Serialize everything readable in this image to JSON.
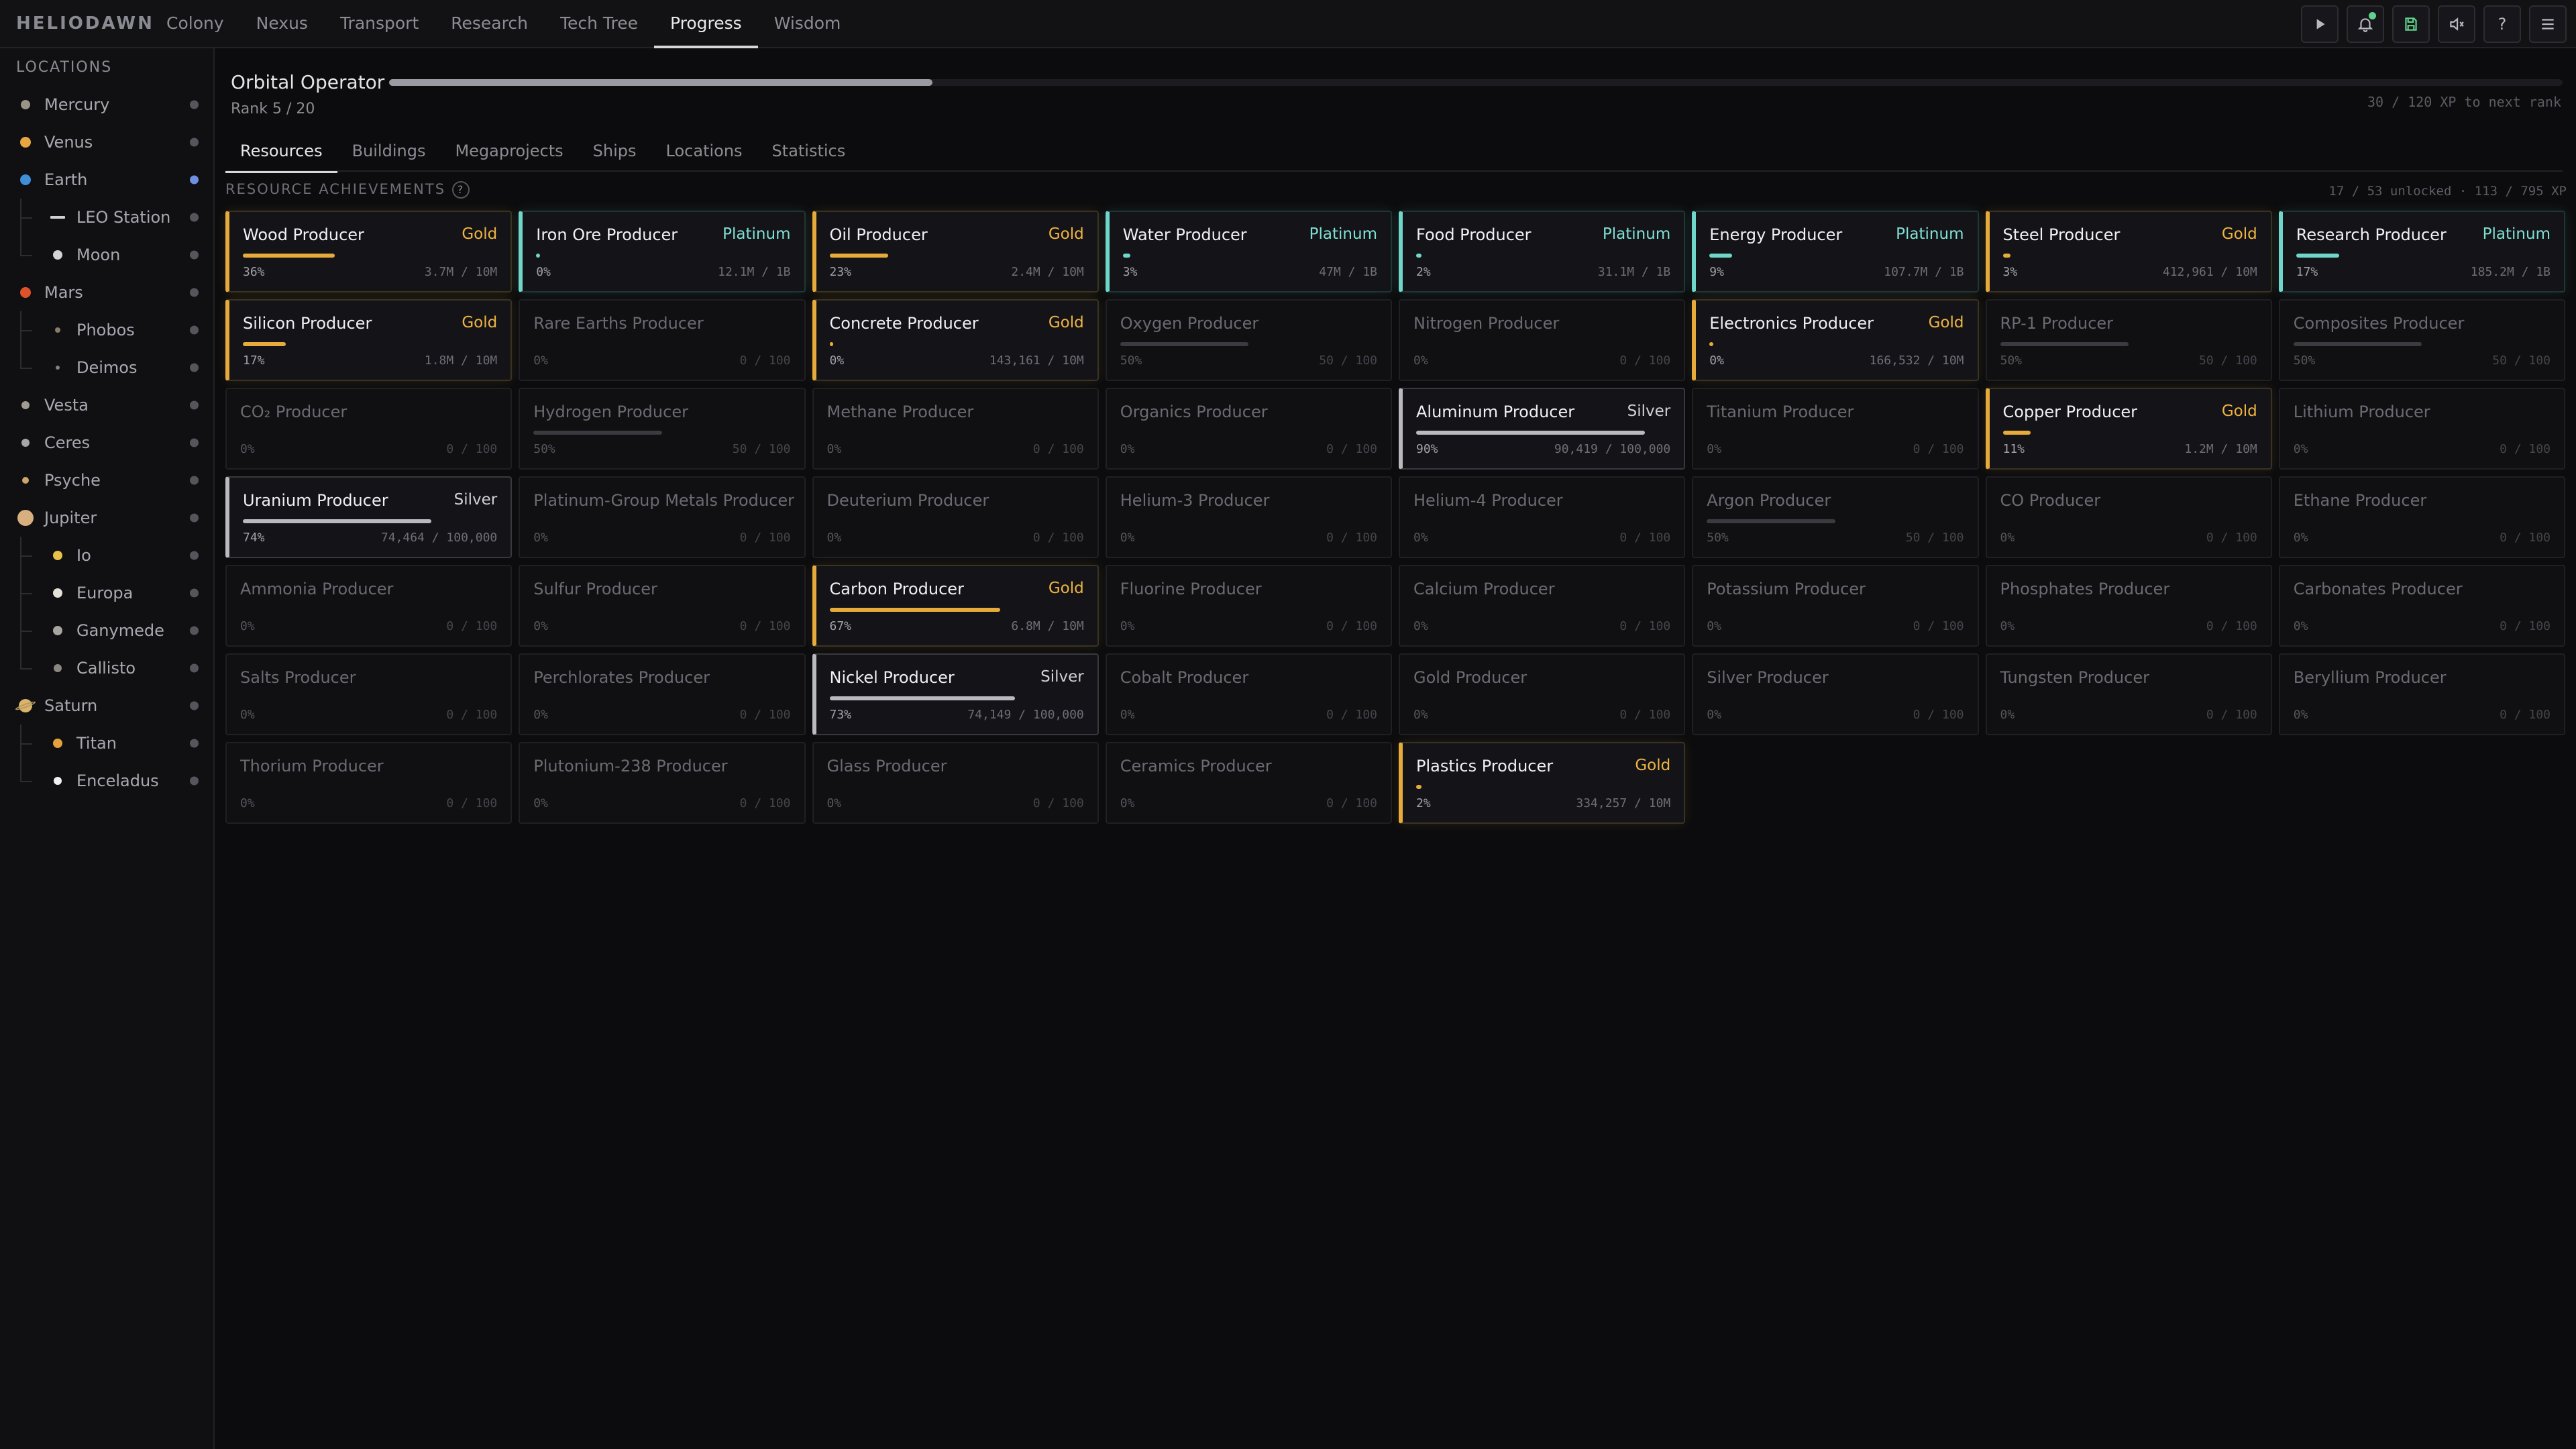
{
  "app": {
    "brand": "HELIODAWN"
  },
  "nav": {
    "tabs": [
      "Colony",
      "Nexus",
      "Transport",
      "Research",
      "Tech Tree",
      "Progress",
      "Wisdom"
    ],
    "active": "Progress"
  },
  "toolbar": {
    "icons": [
      "play-icon",
      "bell-icon",
      "save-icon",
      "mute-icon",
      "help-icon",
      "menu-icon"
    ],
    "help_glyph": "?"
  },
  "sidebar": {
    "title": "LOCATIONS",
    "items": [
      {
        "label": "Mercury",
        "depth": 0,
        "color": "#9a9388",
        "size": 14
      },
      {
        "label": "Venus",
        "depth": 0,
        "color": "#e6a640",
        "size": 16
      },
      {
        "label": "Earth",
        "depth": 0,
        "color": "#3f8fd8",
        "size": 16,
        "status_color": "#6f8fe0"
      },
      {
        "label": "LEO Station",
        "depth": 1,
        "color": "#cfcfd4",
        "size": 6,
        "icon": "station"
      },
      {
        "label": "Moon",
        "depth": 1,
        "color": "#d4d4d8",
        "size": 14
      },
      {
        "label": "Mars",
        "depth": 0,
        "color": "#e0532a",
        "size": 16
      },
      {
        "label": "Phobos",
        "depth": 1,
        "color": "#8a7a66",
        "size": 8
      },
      {
        "label": "Deimos",
        "depth": 1,
        "color": "#8a8078",
        "size": 6
      },
      {
        "label": "Vesta",
        "depth": 0,
        "color": "#a09a90",
        "size": 12
      },
      {
        "label": "Ceres",
        "depth": 0,
        "color": "#a6a6a6",
        "size": 12
      },
      {
        "label": "Psyche",
        "depth": 0,
        "color": "#c9a86a",
        "size": 10
      },
      {
        "label": "Jupiter",
        "depth": 0,
        "color": "#d8b080",
        "size": 24
      },
      {
        "label": "Io",
        "depth": 1,
        "color": "#e8c04a",
        "size": 14
      },
      {
        "label": "Europa",
        "depth": 1,
        "color": "#e6e2d8",
        "size": 14
      },
      {
        "label": "Ganymede",
        "depth": 1,
        "color": "#a8a49e",
        "size": 14
      },
      {
        "label": "Callisto",
        "depth": 1,
        "color": "#8a8680",
        "size": 12
      },
      {
        "label": "Saturn",
        "depth": 0,
        "color": "#d9b46a",
        "size": 20,
        "icon": "ringed"
      },
      {
        "label": "Titan",
        "depth": 1,
        "color": "#e4a23c",
        "size": 14
      },
      {
        "label": "Enceladus",
        "depth": 1,
        "color": "#f0f0f4",
        "size": 12
      }
    ]
  },
  "rank": {
    "title": "Orbital Operator",
    "subtitle": "Rank 5 / 20",
    "xp_text": "30 / 120 XP to next rank",
    "xp_fraction": 0.25
  },
  "subtabs": {
    "items": [
      "Resources",
      "Buildings",
      "Megaprojects",
      "Ships",
      "Locations",
      "Statistics"
    ],
    "active": "Resources"
  },
  "section": {
    "title": "RESOURCE ACHIEVEMENTS",
    "help": "?",
    "summary": "17 / 53 unlocked · 113 / 795 XP"
  },
  "tier_colors": {
    "Gold": "#e6ab3a",
    "Platinum": "#6fd6c9",
    "Silver": "#b9b9c0",
    "none": "#3a3a40"
  },
  "achievements": [
    {
      "name": "Wood Producer",
      "tier": "Gold",
      "pct": "36%",
      "progress": 0.36,
      "value": "3.7M / 10M"
    },
    {
      "name": "Iron Ore Producer",
      "tier": "Platinum",
      "pct": "0%",
      "progress": 0.01,
      "value": "12.1M / 1B"
    },
    {
      "name": "Oil Producer",
      "tier": "Gold",
      "pct": "23%",
      "progress": 0.23,
      "value": "2.4M / 10M"
    },
    {
      "name": "Water Producer",
      "tier": "Platinum",
      "pct": "3%",
      "progress": 0.03,
      "value": "47M / 1B"
    },
    {
      "name": "Food Producer",
      "tier": "Platinum",
      "pct": "2%",
      "progress": 0.02,
      "value": "31.1M / 1B"
    },
    {
      "name": "Energy Producer",
      "tier": "Platinum",
      "pct": "9%",
      "progress": 0.09,
      "value": "107.7M / 1B"
    },
    {
      "name": "Steel Producer",
      "tier": "Gold",
      "pct": "3%",
      "progress": 0.03,
      "value": "412,961 / 10M"
    },
    {
      "name": "Research Producer",
      "tier": "Platinum",
      "pct": "17%",
      "progress": 0.17,
      "value": "185.2M / 1B"
    },
    {
      "name": "Silicon Producer",
      "tier": "Gold",
      "pct": "17%",
      "progress": 0.17,
      "value": "1.8M / 10M"
    },
    {
      "name": "Rare Earths Producer",
      "tier": "",
      "pct": "0%",
      "progress": 0,
      "value": "0 / 100"
    },
    {
      "name": "Concrete Producer",
      "tier": "Gold",
      "pct": "0%",
      "progress": 0.01,
      "value": "143,161 / 10M"
    },
    {
      "name": "Oxygen Producer",
      "tier": "",
      "pct": "50%",
      "progress": 0.5,
      "value": "50 / 100"
    },
    {
      "name": "Nitrogen Producer",
      "tier": "",
      "pct": "0%",
      "progress": 0,
      "value": "0 / 100"
    },
    {
      "name": "Electronics Producer",
      "tier": "Gold",
      "pct": "0%",
      "progress": 0.01,
      "value": "166,532 / 10M"
    },
    {
      "name": "RP-1 Producer",
      "tier": "",
      "pct": "50%",
      "progress": 0.5,
      "value": "50 / 100"
    },
    {
      "name": "Composites Producer",
      "tier": "",
      "pct": "50%",
      "progress": 0.5,
      "value": "50 / 100"
    },
    {
      "name": "CO₂ Producer",
      "tier": "",
      "pct": "0%",
      "progress": 0,
      "value": "0 / 100"
    },
    {
      "name": "Hydrogen Producer",
      "tier": "",
      "pct": "50%",
      "progress": 0.5,
      "value": "50 / 100"
    },
    {
      "name": "Methane Producer",
      "tier": "",
      "pct": "0%",
      "progress": 0,
      "value": "0 / 100"
    },
    {
      "name": "Organics Producer",
      "tier": "",
      "pct": "0%",
      "progress": 0,
      "value": "0 / 100"
    },
    {
      "name": "Aluminum Producer",
      "tier": "Silver",
      "pct": "90%",
      "progress": 0.9,
      "value": "90,419 / 100,000"
    },
    {
      "name": "Titanium Producer",
      "tier": "",
      "pct": "0%",
      "progress": 0,
      "value": "0 / 100"
    },
    {
      "name": "Copper Producer",
      "tier": "Gold",
      "pct": "11%",
      "progress": 0.11,
      "value": "1.2M / 10M"
    },
    {
      "name": "Lithium Producer",
      "tier": "",
      "pct": "0%",
      "progress": 0,
      "value": "0 / 100"
    },
    {
      "name": "Uranium Producer",
      "tier": "Silver",
      "pct": "74%",
      "progress": 0.74,
      "value": "74,464 / 100,000"
    },
    {
      "name": "Platinum-Group Metals Producer",
      "tier": "",
      "pct": "0%",
      "progress": 0,
      "value": "0 / 100"
    },
    {
      "name": "Deuterium Producer",
      "tier": "",
      "pct": "0%",
      "progress": 0,
      "value": "0 / 100"
    },
    {
      "name": "Helium-3 Producer",
      "tier": "",
      "pct": "0%",
      "progress": 0,
      "value": "0 / 100"
    },
    {
      "name": "Helium-4 Producer",
      "tier": "",
      "pct": "0%",
      "progress": 0,
      "value": "0 / 100"
    },
    {
      "name": "Argon Producer",
      "tier": "",
      "pct": "50%",
      "progress": 0.5,
      "value": "50 / 100"
    },
    {
      "name": "CO Producer",
      "tier": "",
      "pct": "0%",
      "progress": 0,
      "value": "0 / 100"
    },
    {
      "name": "Ethane Producer",
      "tier": "",
      "pct": "0%",
      "progress": 0,
      "value": "0 / 100"
    },
    {
      "name": "Ammonia Producer",
      "tier": "",
      "pct": "0%",
      "progress": 0,
      "value": "0 / 100"
    },
    {
      "name": "Sulfur Producer",
      "tier": "",
      "pct": "0%",
      "progress": 0,
      "value": "0 / 100"
    },
    {
      "name": "Carbon Producer",
      "tier": "Gold",
      "pct": "67%",
      "progress": 0.67,
      "value": "6.8M / 10M"
    },
    {
      "name": "Fluorine Producer",
      "tier": "",
      "pct": "0%",
      "progress": 0,
      "value": "0 / 100"
    },
    {
      "name": "Calcium Producer",
      "tier": "",
      "pct": "0%",
      "progress": 0,
      "value": "0 / 100"
    },
    {
      "name": "Potassium Producer",
      "tier": "",
      "pct": "0%",
      "progress": 0,
      "value": "0 / 100"
    },
    {
      "name": "Phosphates Producer",
      "tier": "",
      "pct": "0%",
      "progress": 0,
      "value": "0 / 100"
    },
    {
      "name": "Carbonates Producer",
      "tier": "",
      "pct": "0%",
      "progress": 0,
      "value": "0 / 100"
    },
    {
      "name": "Salts Producer",
      "tier": "",
      "pct": "0%",
      "progress": 0,
      "value": "0 / 100"
    },
    {
      "name": "Perchlorates Producer",
      "tier": "",
      "pct": "0%",
      "progress": 0,
      "value": "0 / 100"
    },
    {
      "name": "Nickel Producer",
      "tier": "Silver",
      "pct": "73%",
      "progress": 0.73,
      "value": "74,149 / 100,000"
    },
    {
      "name": "Cobalt Producer",
      "tier": "",
      "pct": "0%",
      "progress": 0,
      "value": "0 / 100"
    },
    {
      "name": "Gold Producer",
      "tier": "",
      "pct": "0%",
      "progress": 0,
      "value": "0 / 100"
    },
    {
      "name": "Silver Producer",
      "tier": "",
      "pct": "0%",
      "progress": 0,
      "value": "0 / 100"
    },
    {
      "name": "Tungsten Producer",
      "tier": "",
      "pct": "0%",
      "progress": 0,
      "value": "0 / 100"
    },
    {
      "name": "Beryllium Producer",
      "tier": "",
      "pct": "0%",
      "progress": 0,
      "value": "0 / 100"
    },
    {
      "name": "Thorium Producer",
      "tier": "",
      "pct": "0%",
      "progress": 0,
      "value": "0 / 100"
    },
    {
      "name": "Plutonium-238 Producer",
      "tier": "",
      "pct": "0%",
      "progress": 0,
      "value": "0 / 100"
    },
    {
      "name": "Glass Producer",
      "tier": "",
      "pct": "0%",
      "progress": 0,
      "value": "0 / 100"
    },
    {
      "name": "Ceramics Producer",
      "tier": "",
      "pct": "0%",
      "progress": 0,
      "value": "0 / 100"
    },
    {
      "name": "Plastics Producer",
      "tier": "Gold",
      "pct": "2%",
      "progress": 0.02,
      "value": "334,257 / 10M"
    }
  ]
}
